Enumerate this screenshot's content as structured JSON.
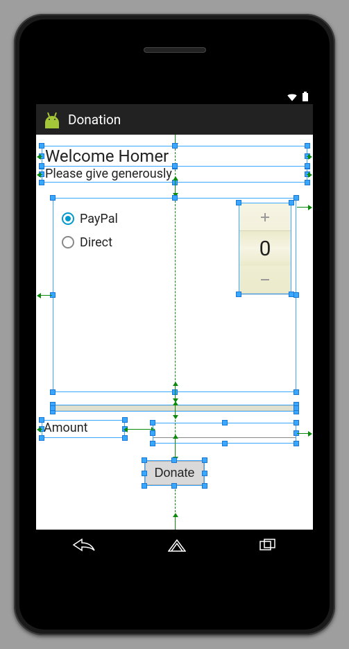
{
  "status": {
    "wifi": true,
    "battery": true
  },
  "actionBar": {
    "title": "Donation"
  },
  "welcome": "Welcome Homer",
  "subtitle": "Please give generously",
  "paymentOptions": {
    "paypal": {
      "label": "PayPal",
      "selected": true
    },
    "direct": {
      "label": "Direct",
      "selected": false
    }
  },
  "numberPicker": {
    "value": "0"
  },
  "progress": {
    "value": 0
  },
  "amount": {
    "label": "Amount",
    "value": ""
  },
  "donateButton": {
    "label": "Donate"
  }
}
